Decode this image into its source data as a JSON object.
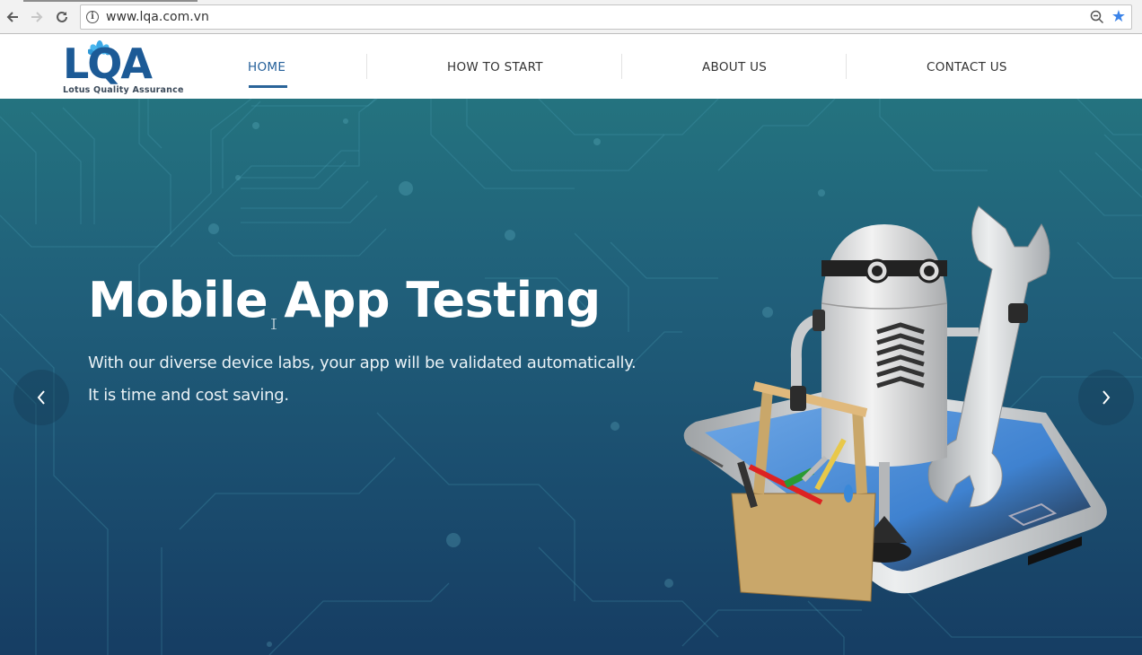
{
  "browser": {
    "url": "www.lqa.com.vn",
    "back_icon": "arrow-left-icon",
    "forward_icon": "arrow-right-icon",
    "reload_icon": "reload-icon",
    "info_icon": "info-icon",
    "zoom_icon": "zoom-out-icon",
    "bookmark_icon": "star-icon",
    "bookmark_color": "#3b83e8"
  },
  "header": {
    "logo": {
      "letters": "LQA",
      "tagline": "Lotus Quality Assurance",
      "brand_color": "#1c5a96",
      "lotus_color": "#3aa8e6"
    },
    "nav": [
      {
        "label": "HOME",
        "active": true
      },
      {
        "label": "HOW TO START",
        "active": false
      },
      {
        "label": "ABOUT US",
        "active": false
      },
      {
        "label": "CONTACT US",
        "active": false
      }
    ],
    "active_color": "#25609a"
  },
  "hero": {
    "title": "Mobile App Testing",
    "subtitle_line1": "With our diverse device labs, your app will be validated automatically.",
    "subtitle_line2": "It is time and cost saving.",
    "prev_label": "‹",
    "next_label": "›",
    "illustration": "robot-with-wrench-and-toolbox-on-smartphone",
    "bg_colors": [
      "#24737f",
      "#163d63"
    ]
  }
}
